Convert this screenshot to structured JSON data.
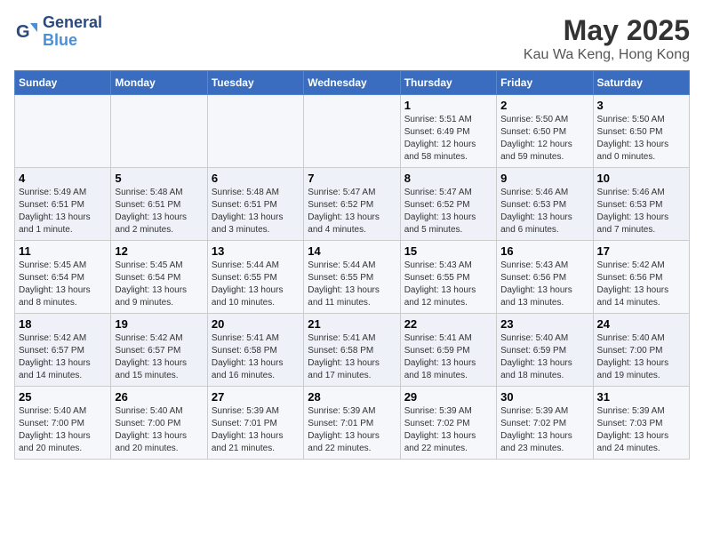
{
  "header": {
    "logo_line1": "General",
    "logo_line2": "Blue",
    "title": "May 2025",
    "subtitle": "Kau Wa Keng, Hong Kong"
  },
  "weekdays": [
    "Sunday",
    "Monday",
    "Tuesday",
    "Wednesday",
    "Thursday",
    "Friday",
    "Saturday"
  ],
  "weeks": [
    [
      {
        "day": "",
        "info": ""
      },
      {
        "day": "",
        "info": ""
      },
      {
        "day": "",
        "info": ""
      },
      {
        "day": "",
        "info": ""
      },
      {
        "day": "1",
        "info": "Sunrise: 5:51 AM\nSunset: 6:49 PM\nDaylight: 12 hours\nand 58 minutes."
      },
      {
        "day": "2",
        "info": "Sunrise: 5:50 AM\nSunset: 6:50 PM\nDaylight: 12 hours\nand 59 minutes."
      },
      {
        "day": "3",
        "info": "Sunrise: 5:50 AM\nSunset: 6:50 PM\nDaylight: 13 hours\nand 0 minutes."
      }
    ],
    [
      {
        "day": "4",
        "info": "Sunrise: 5:49 AM\nSunset: 6:51 PM\nDaylight: 13 hours\nand 1 minute."
      },
      {
        "day": "5",
        "info": "Sunrise: 5:48 AM\nSunset: 6:51 PM\nDaylight: 13 hours\nand 2 minutes."
      },
      {
        "day": "6",
        "info": "Sunrise: 5:48 AM\nSunset: 6:51 PM\nDaylight: 13 hours\nand 3 minutes."
      },
      {
        "day": "7",
        "info": "Sunrise: 5:47 AM\nSunset: 6:52 PM\nDaylight: 13 hours\nand 4 minutes."
      },
      {
        "day": "8",
        "info": "Sunrise: 5:47 AM\nSunset: 6:52 PM\nDaylight: 13 hours\nand 5 minutes."
      },
      {
        "day": "9",
        "info": "Sunrise: 5:46 AM\nSunset: 6:53 PM\nDaylight: 13 hours\nand 6 minutes."
      },
      {
        "day": "10",
        "info": "Sunrise: 5:46 AM\nSunset: 6:53 PM\nDaylight: 13 hours\nand 7 minutes."
      }
    ],
    [
      {
        "day": "11",
        "info": "Sunrise: 5:45 AM\nSunset: 6:54 PM\nDaylight: 13 hours\nand 8 minutes."
      },
      {
        "day": "12",
        "info": "Sunrise: 5:45 AM\nSunset: 6:54 PM\nDaylight: 13 hours\nand 9 minutes."
      },
      {
        "day": "13",
        "info": "Sunrise: 5:44 AM\nSunset: 6:55 PM\nDaylight: 13 hours\nand 10 minutes."
      },
      {
        "day": "14",
        "info": "Sunrise: 5:44 AM\nSunset: 6:55 PM\nDaylight: 13 hours\nand 11 minutes."
      },
      {
        "day": "15",
        "info": "Sunrise: 5:43 AM\nSunset: 6:55 PM\nDaylight: 13 hours\nand 12 minutes."
      },
      {
        "day": "16",
        "info": "Sunrise: 5:43 AM\nSunset: 6:56 PM\nDaylight: 13 hours\nand 13 minutes."
      },
      {
        "day": "17",
        "info": "Sunrise: 5:42 AM\nSunset: 6:56 PM\nDaylight: 13 hours\nand 14 minutes."
      }
    ],
    [
      {
        "day": "18",
        "info": "Sunrise: 5:42 AM\nSunset: 6:57 PM\nDaylight: 13 hours\nand 14 minutes."
      },
      {
        "day": "19",
        "info": "Sunrise: 5:42 AM\nSunset: 6:57 PM\nDaylight: 13 hours\nand 15 minutes."
      },
      {
        "day": "20",
        "info": "Sunrise: 5:41 AM\nSunset: 6:58 PM\nDaylight: 13 hours\nand 16 minutes."
      },
      {
        "day": "21",
        "info": "Sunrise: 5:41 AM\nSunset: 6:58 PM\nDaylight: 13 hours\nand 17 minutes."
      },
      {
        "day": "22",
        "info": "Sunrise: 5:41 AM\nSunset: 6:59 PM\nDaylight: 13 hours\nand 18 minutes."
      },
      {
        "day": "23",
        "info": "Sunrise: 5:40 AM\nSunset: 6:59 PM\nDaylight: 13 hours\nand 18 minutes."
      },
      {
        "day": "24",
        "info": "Sunrise: 5:40 AM\nSunset: 7:00 PM\nDaylight: 13 hours\nand 19 minutes."
      }
    ],
    [
      {
        "day": "25",
        "info": "Sunrise: 5:40 AM\nSunset: 7:00 PM\nDaylight: 13 hours\nand 20 minutes."
      },
      {
        "day": "26",
        "info": "Sunrise: 5:40 AM\nSunset: 7:00 PM\nDaylight: 13 hours\nand 20 minutes."
      },
      {
        "day": "27",
        "info": "Sunrise: 5:39 AM\nSunset: 7:01 PM\nDaylight: 13 hours\nand 21 minutes."
      },
      {
        "day": "28",
        "info": "Sunrise: 5:39 AM\nSunset: 7:01 PM\nDaylight: 13 hours\nand 22 minutes."
      },
      {
        "day": "29",
        "info": "Sunrise: 5:39 AM\nSunset: 7:02 PM\nDaylight: 13 hours\nand 22 minutes."
      },
      {
        "day": "30",
        "info": "Sunrise: 5:39 AM\nSunset: 7:02 PM\nDaylight: 13 hours\nand 23 minutes."
      },
      {
        "day": "31",
        "info": "Sunrise: 5:39 AM\nSunset: 7:03 PM\nDaylight: 13 hours\nand 24 minutes."
      }
    ]
  ]
}
